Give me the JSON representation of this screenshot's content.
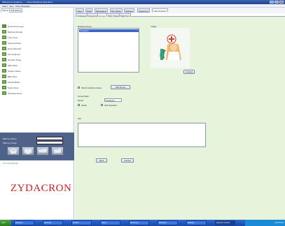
{
  "window": {
    "title": "Welcome to Zydacron ... - Client Workbook (Operator)"
  },
  "menubar": {
    "items": [
      "Client",
      "View",
      "Client Playback"
    ]
  },
  "left_panel": {
    "tabs": [
      "Clients",
      "Call History"
    ],
    "clients": [
      "Ernest Kuhn-uga",
      "Barbara Zinclair",
      "Fran Tuner",
      "Sheena Potter",
      "Ernst Schmidt",
      "Lilo Anderson",
      "Jennifer Trago",
      "Willy Steer",
      "Johann Heine",
      "Blair Hind",
      "Kandis Butler",
      "Susie Stout",
      "Penelope Rose"
    ],
    "filter": {
      "filter_name_label": "Filter by Name",
      "filter_group_label": "Filter by Group",
      "count_text": "14 of 14 (clients)"
    }
  },
  "logo": {
    "text": "ZYDACRON",
    "brand_color": "#c41f1f"
  },
  "top_tabs": [
    "Video",
    "Data",
    "Messaging",
    "File Share",
    "Settings",
    "Streaming",
    "Administration"
  ],
  "sub_tabs": [
    "Colleagues",
    "Operators",
    "Groups",
    "Work Status",
    "Machines"
  ],
  "groups": {
    "existing_label": "Existing Group",
    "items": [
      "Caregiver"
    ],
    "image_label": "Image",
    "upload_button": "Upload",
    "show_inactive_label": "Show Inactive Groups",
    "add_button": "Add Group",
    "details_title": "Group Data",
    "name_label": "Name",
    "name_value": "Caregiver",
    "active_label": "Active",
    "call_operator_label": "Call Operator",
    "notes_label": "Info",
    "save_button": "Save",
    "cancel_button": "Cancel"
  },
  "taskbar": {
    "start_label": "start",
    "items": [
      "Zydacron",
      "Welcome",
      "Mozilla...",
      "Client...",
      "Document...",
      "Microsoft...",
      "Desktop...",
      "Zydacron Control"
    ],
    "clock": "12:45 PM"
  },
  "colors": {
    "accent": "#3a68c9",
    "panel_green": "#e6f4dc",
    "filter_panel": "#4e628a"
  }
}
